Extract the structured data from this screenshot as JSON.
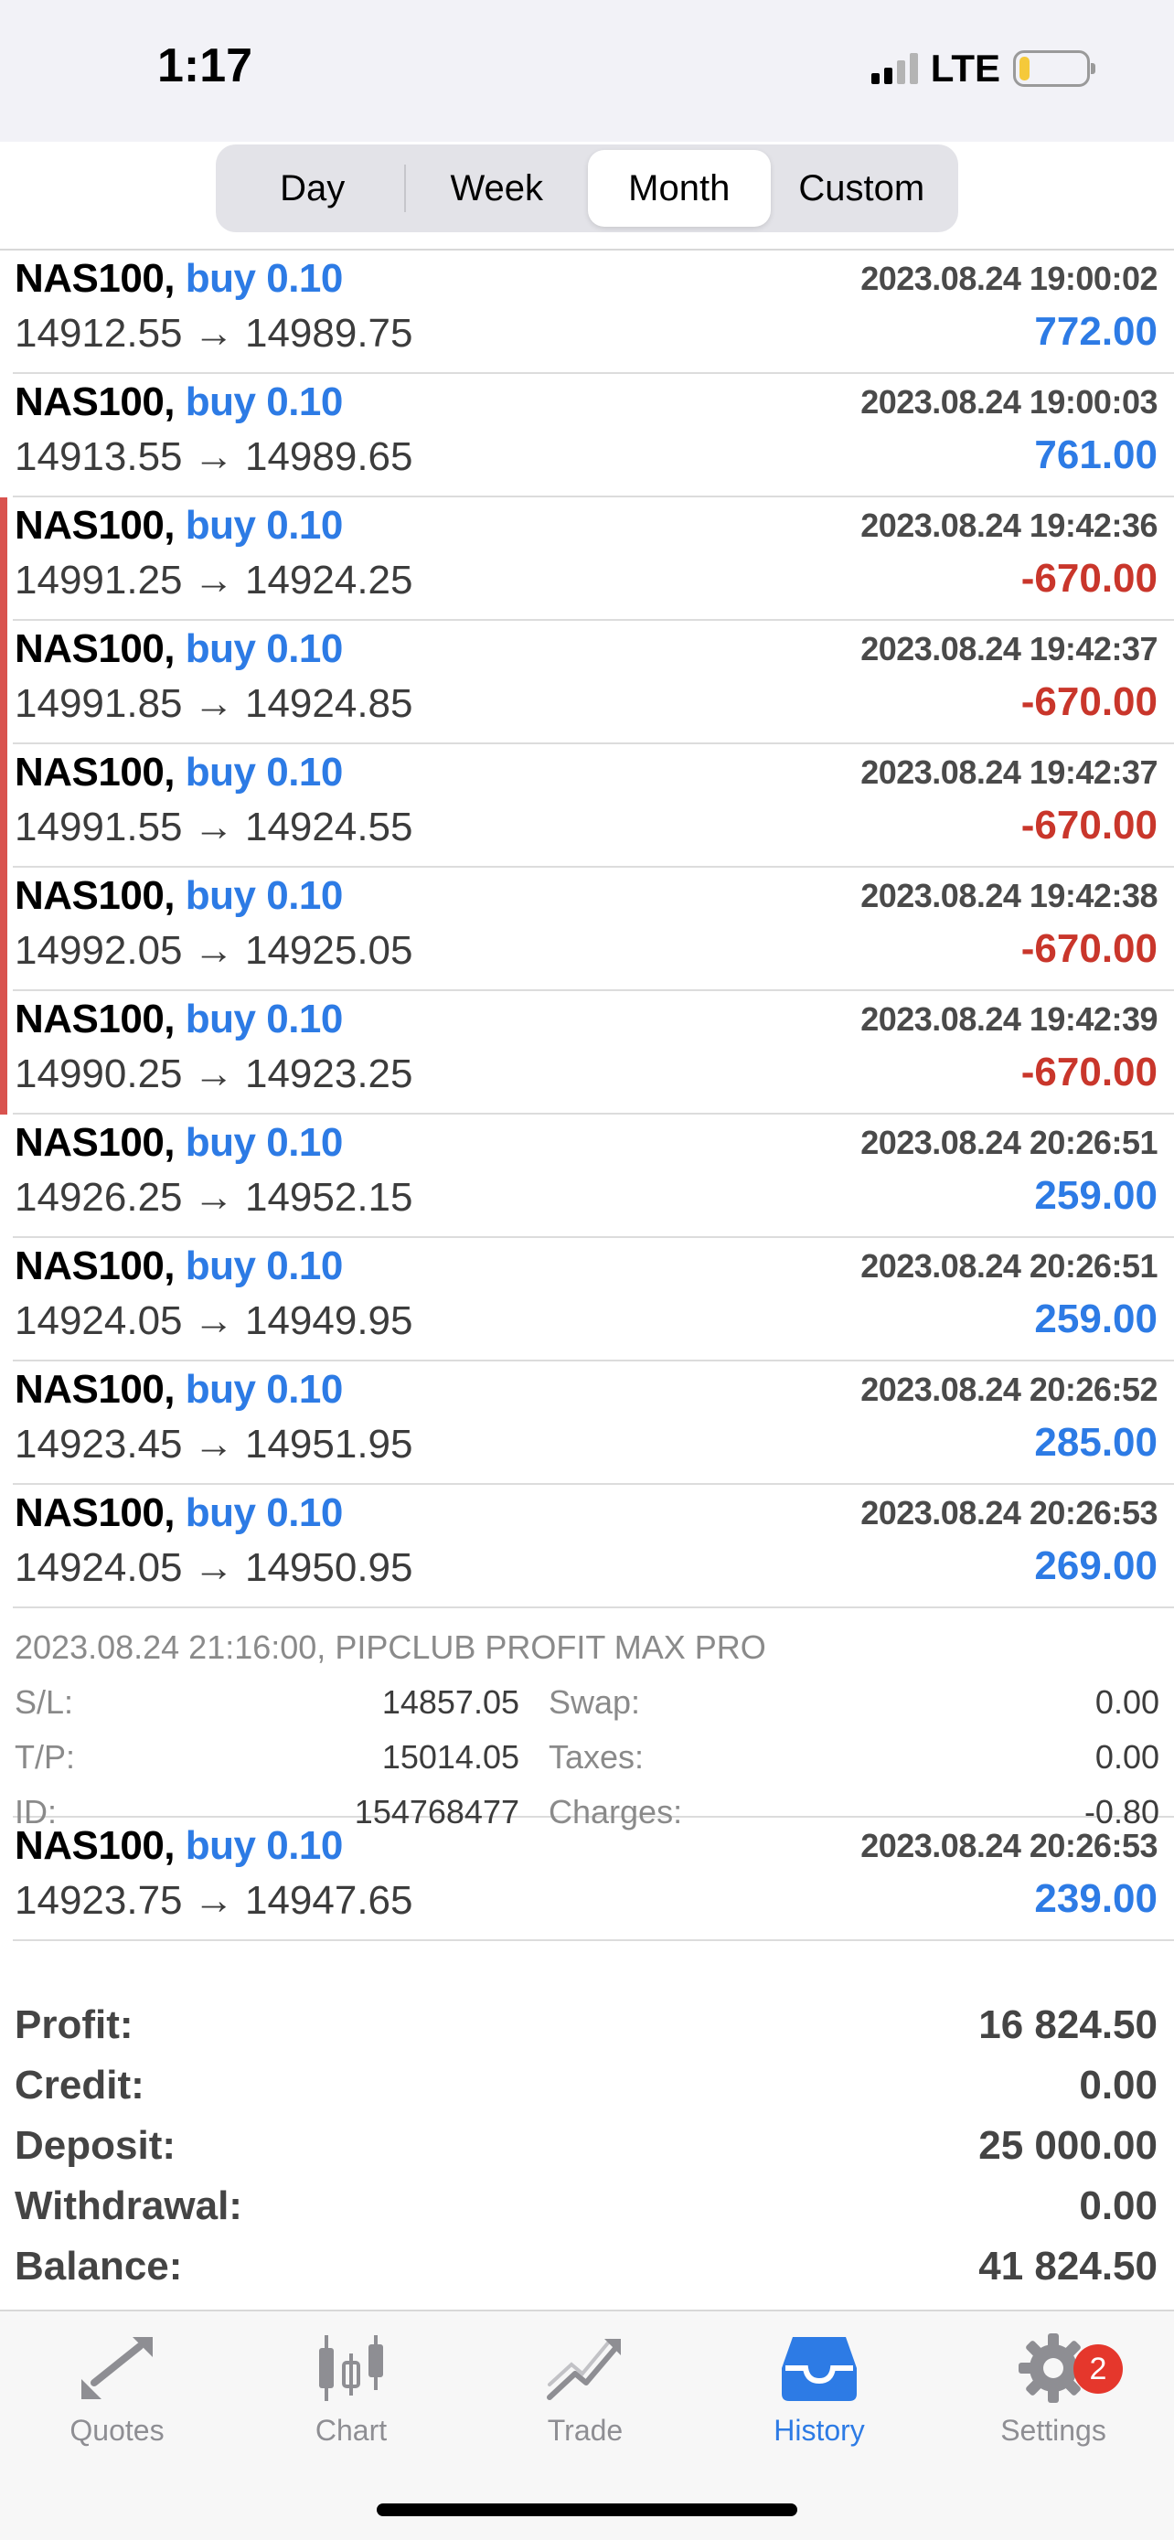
{
  "status_bar": {
    "time": "1:17",
    "network": "LTE"
  },
  "period_tabs": [
    {
      "label": "Day",
      "active": false
    },
    {
      "label": "Week",
      "active": false
    },
    {
      "label": "Month",
      "active": true
    },
    {
      "label": "Custom",
      "active": false
    }
  ],
  "trades_top": [
    {
      "symbol": "NAS100,",
      "type": "buy 0.10",
      "prices": "14912.55 → 14989.75",
      "time": "2023.08.24 19:00:02",
      "profit": "772.00",
      "negative": false
    },
    {
      "symbol": "NAS100,",
      "type": "buy 0.10",
      "prices": "14913.55 → 14989.65",
      "time": "2023.08.24 19:00:03",
      "profit": "761.00",
      "negative": false
    },
    {
      "symbol": "NAS100,",
      "type": "buy 0.10",
      "prices": "14991.25 → 14924.25",
      "time": "2023.08.24 19:42:36",
      "profit": "-670.00",
      "negative": true
    },
    {
      "symbol": "NAS100,",
      "type": "buy 0.10",
      "prices": "14991.85 → 14924.85",
      "time": "2023.08.24 19:42:37",
      "profit": "-670.00",
      "negative": true
    },
    {
      "symbol": "NAS100,",
      "type": "buy 0.10",
      "prices": "14991.55 → 14924.55",
      "time": "2023.08.24 19:42:37",
      "profit": "-670.00",
      "negative": true
    },
    {
      "symbol": "NAS100,",
      "type": "buy 0.10",
      "prices": "14992.05 → 14925.05",
      "time": "2023.08.24 19:42:38",
      "profit": "-670.00",
      "negative": true
    },
    {
      "symbol": "NAS100,",
      "type": "buy 0.10",
      "prices": "14990.25 → 14923.25",
      "time": "2023.08.24 19:42:39",
      "profit": "-670.00",
      "negative": true
    },
    {
      "symbol": "NAS100,",
      "type": "buy 0.10",
      "prices": "14926.25 → 14952.15",
      "time": "2023.08.24 20:26:51",
      "profit": "259.00",
      "negative": false
    },
    {
      "symbol": "NAS100,",
      "type": "buy 0.10",
      "prices": "14924.05 → 14949.95",
      "time": "2023.08.24 20:26:51",
      "profit": "259.00",
      "negative": false
    },
    {
      "symbol": "NAS100,",
      "type": "buy 0.10",
      "prices": "14923.45 → 14951.95",
      "time": "2023.08.24 20:26:52",
      "profit": "285.00",
      "negative": false
    },
    {
      "symbol": "NAS100,",
      "type": "buy 0.10",
      "prices": "14924.05 → 14950.95",
      "time": "2023.08.24 20:26:53",
      "profit": "269.00",
      "negative": false
    }
  ],
  "detail": {
    "header": "2023.08.24 21:16:00, PIPCLUB PROFIT MAX PRO",
    "rows": [
      {
        "l1": "S/L:",
        "v1": "14857.05",
        "l2": "Swap:",
        "v2": "0.00"
      },
      {
        "l1": "T/P:",
        "v1": "15014.05",
        "l2": "Taxes:",
        "v2": "0.00"
      },
      {
        "l1": "ID:",
        "v1": "154768477",
        "l2": "Charges:",
        "v2": "-0.80"
      }
    ]
  },
  "trades_bottom": [
    {
      "symbol": "NAS100,",
      "type": "buy 0.10",
      "prices": "14923.75 → 14947.65",
      "time": "2023.08.24 20:26:53",
      "profit": "239.00",
      "negative": false
    }
  ],
  "summary": [
    {
      "label": "Profit:",
      "value": "16 824.50"
    },
    {
      "label": "Credit:",
      "value": "0.00"
    },
    {
      "label": "Deposit:",
      "value": "25 000.00"
    },
    {
      "label": "Withdrawal:",
      "value": "0.00"
    },
    {
      "label": "Balance:",
      "value": "41 824.50"
    }
  ],
  "tabbar": [
    {
      "label": "Quotes",
      "icon": "quotes-arrows-icon",
      "active": false
    },
    {
      "label": "Chart",
      "icon": "candlestick-icon",
      "active": false
    },
    {
      "label": "Trade",
      "icon": "trend-line-icon",
      "active": false
    },
    {
      "label": "History",
      "icon": "inbox-tray-icon",
      "active": true
    },
    {
      "label": "Settings",
      "icon": "gear-icon",
      "active": false,
      "badge": "2"
    }
  ],
  "colors": {
    "accent": "#2d7be5",
    "loss": "#c9362b",
    "loss_bar": "#d9534f"
  }
}
